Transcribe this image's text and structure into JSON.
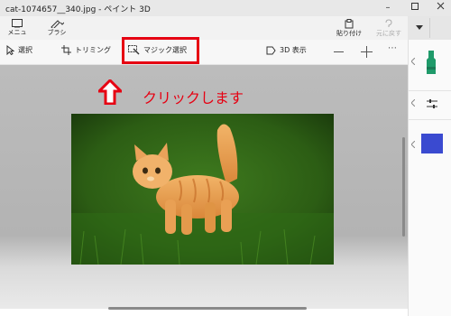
{
  "window": {
    "title": "cat-1074657__340.jpg - ペイント 3D"
  },
  "ribbon": {
    "menu_label": "メニュー",
    "brush_label": "ブラシ",
    "paste_label": "貼り付け",
    "undo_label": "元に戻す"
  },
  "toolbar": {
    "select_label": "選択",
    "crop_label": "トリミング",
    "magic_select_label": "マジック選択",
    "view3d_label": "3D 表示"
  },
  "annotation": {
    "text": "クリックします",
    "color": "#e60012"
  },
  "colors": {
    "accent_swatch": "#3a4ad0",
    "marker_green": "#1f9a6a"
  }
}
